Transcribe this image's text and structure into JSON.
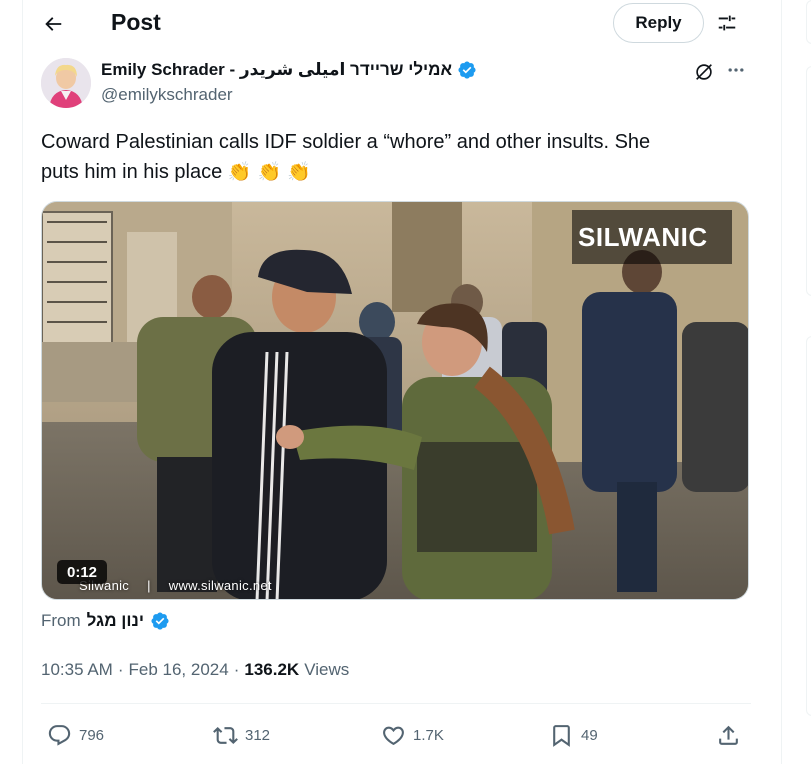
{
  "header": {
    "title": "Post",
    "reply_label": "Reply"
  },
  "post": {
    "author": {
      "display_name": "Emily Schrader - אמילי שריידר اميلى شريدر",
      "handle": "@emilykschrader",
      "verified": true
    },
    "text_line1": "Coward Palestinian calls IDF soldier a “whore” and other insults. She",
    "text_line2": "puts him in his place",
    "emojis": "👏 👏 👏",
    "video": {
      "duration": "0:12",
      "watermark_top": "SILWANIC",
      "watermark_handle": "Silwanic",
      "watermark_site": "www.silwanic.net"
    },
    "from": {
      "label": "From",
      "name": "ינון מגל",
      "verified": true
    },
    "time": "10:35 AM",
    "date": "Feb 16, 2024",
    "separator": "·",
    "views": {
      "count": "136.2K",
      "label": "Views"
    },
    "stats": {
      "replies": "796",
      "reposts": "312",
      "likes": "1.7K",
      "bookmarks": "49"
    }
  },
  "colors": {
    "verified": "#1d9bf0",
    "muted": "#536471",
    "text": "#0f1419",
    "border": "#cfd9de"
  },
  "icons": [
    "back-arrow-icon",
    "filter-icon",
    "verified-icon",
    "grok-icon",
    "more-icon",
    "reply-icon",
    "repost-icon",
    "like-icon",
    "bookmark-icon",
    "share-icon"
  ]
}
